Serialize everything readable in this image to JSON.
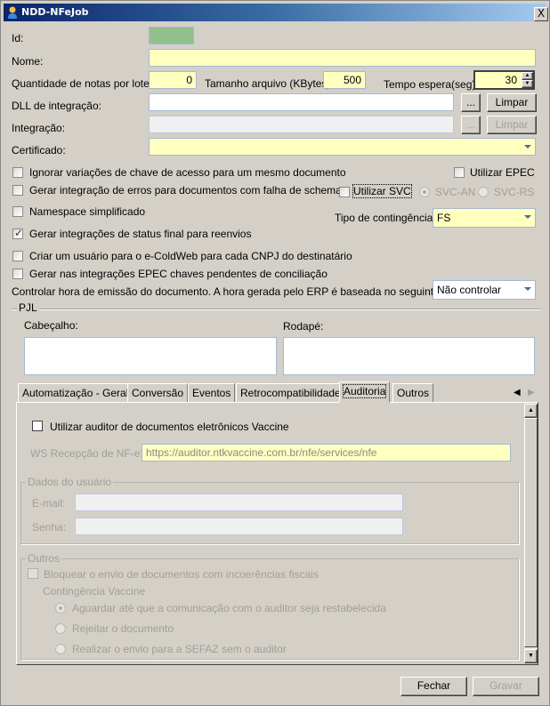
{
  "window": {
    "title": "NDD-NFeJob",
    "close": "X"
  },
  "form": {
    "id_label": "Id:",
    "nome_label": "Nome:",
    "nome_value": "",
    "qtd_label": "Quantidade de notas por lote:",
    "qtd_value": "0",
    "tamanho_label": "Tamanho arquivo (KBytes):",
    "tamanho_value": "500",
    "tempo_label": "Tempo espera(seg):",
    "tempo_value": "30",
    "dll_label": "DLL de integração:",
    "dll_value": "",
    "browse": "...",
    "limpar": "Limpar",
    "integracao_label": "Integração:",
    "certificado_label": "Certificado:"
  },
  "options": [
    {
      "label": "Ignorar variações de chave de acesso para um mesmo documento",
      "checked": false
    },
    {
      "label": "Gerar integração de erros para documentos com falha de schema",
      "checked": false
    },
    {
      "label": "Namespace simplificado",
      "checked": false
    },
    {
      "label": "Gerar integrações de status final para reenvios",
      "checked": true
    },
    {
      "label": "Criar um usuário para o e-ColdWeb para cada CNPJ do destinatário",
      "checked": false
    },
    {
      "label": "Gerar nas integrações EPEC chaves pendentes de conciliação",
      "checked": false
    }
  ],
  "epec": {
    "label": "Utilizar EPEC",
    "checked": false
  },
  "svc": {
    "label": "Utilizar SVC",
    "checked": false,
    "svc_an": "SVC-AN",
    "svc_rs": "SVC-RS",
    "selected": "SVC-AN"
  },
  "contingencia": {
    "label": "Tipo de contingência:",
    "value": "FS"
  },
  "hora": {
    "label": "Controlar hora de emissão do documento. A hora gerada pelo ERP é baseada no seguinte estado:",
    "value": "Não controlar"
  },
  "pjl": {
    "title": "PJL",
    "cabecalho": "Cabeçalho:",
    "rodape": "Rodapé:"
  },
  "tabs": [
    "Automatização - Geral",
    "Conversão",
    "Eventos",
    "Retrocompatibilidade",
    "Auditoria",
    "Outros"
  ],
  "active_tab": "Auditoria",
  "auditoria": {
    "usar_label": "Utilizar auditor de documentos eletrônicos Vaccine",
    "usar_checked": false,
    "ws_label": "WS Recepção de NF-e:",
    "ws_value": "https://auditor.ntkvaccine.com.br/nfe/services/nfe",
    "dados_title": "Dados do usuário",
    "email_label": "E-mail:",
    "senha_label": "Senha:",
    "outros_title": "Outros",
    "bloquear_label": "Bloquear o envio de documentos com incoerências fiscais",
    "contingencia_label": "Contingência Vaccine",
    "radios": [
      "Aguardar até que a comunicação com o auditor seja restabelecida",
      "Rejeitar o documento",
      "Realizar o envio para a SEFAZ sem o auditor"
    ],
    "selected_radio": 0
  },
  "buttons": {
    "fechar": "Fechar",
    "gravar": "Gravar"
  }
}
